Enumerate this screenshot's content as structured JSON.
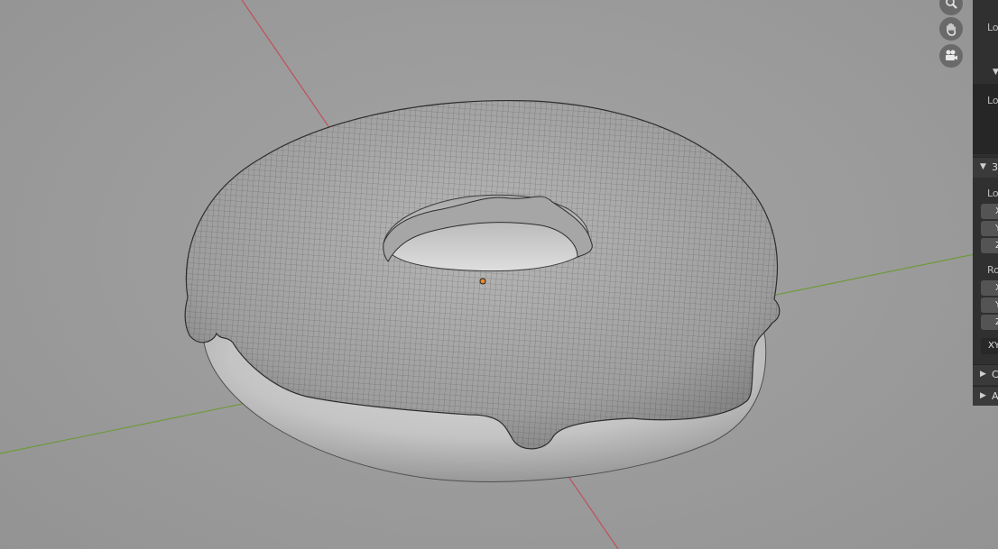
{
  "viewport": {
    "background": "#9a9a9a",
    "axis_x_color": "#c0505a",
    "axis_y_color": "#6e9a3a",
    "object_name": "donut",
    "origin_color": "#f08a24"
  },
  "nav_gizmo": {
    "zoom_icon": "magnifier-icon",
    "pan_icon": "hand-icon",
    "camera_icon": "camera-icon"
  },
  "npanel": {
    "top_label_1": "Lo",
    "top_label_2": "Lo",
    "section_3d_cursor": {
      "title": "3",
      "location_label": "Lo",
      "location_fields": [
        "X",
        "Y",
        "Z"
      ],
      "rotation_label": "Ro",
      "rotation_fields": [
        "X",
        "Y",
        "Z"
      ],
      "rotation_mode": "XY"
    },
    "collapsed_sections": [
      "C",
      "A"
    ]
  }
}
